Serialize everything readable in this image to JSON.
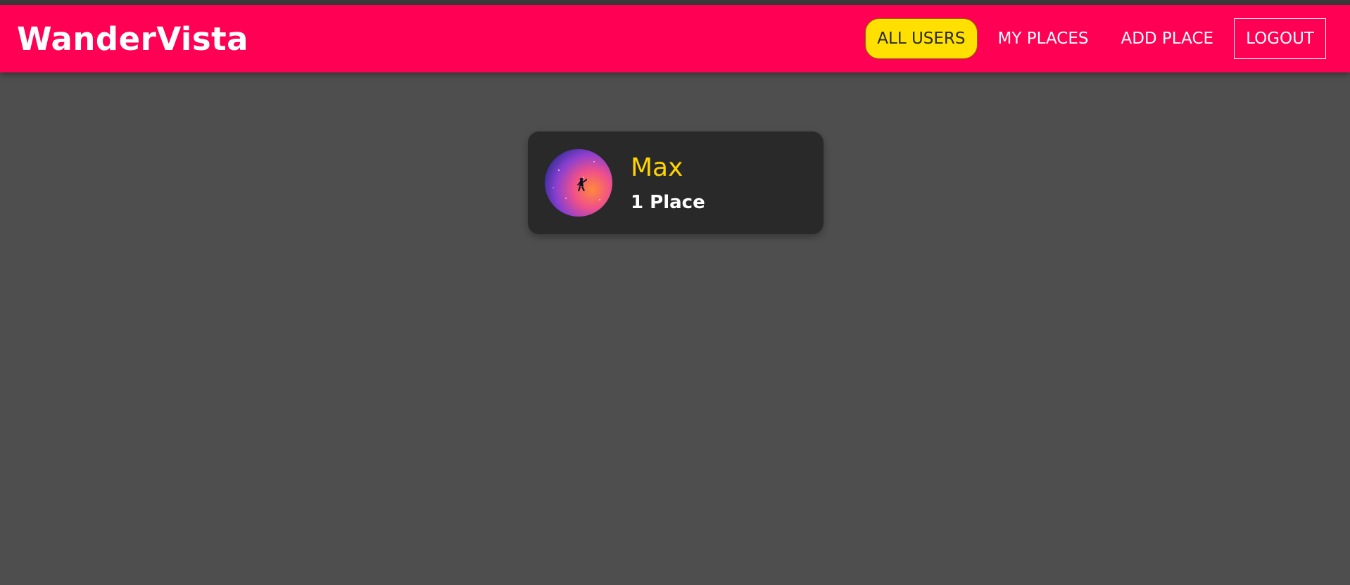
{
  "header": {
    "logo": "WanderVista",
    "background_color": "#ff0055",
    "nav": [
      {
        "label": "ALL USERS",
        "active": true
      },
      {
        "label": "MY PLACES"
      },
      {
        "label": "ADD PLACE"
      },
      {
        "label": "LOGOUT"
      }
    ]
  },
  "users": [
    {
      "name": "Max",
      "places": "1 Place",
      "avatar": "galaxy-person-avatar"
    }
  ],
  "colors": {
    "page_background": "#4e4e4e",
    "card_background": "#292929",
    "accent_yellow": "#ffd400"
  }
}
